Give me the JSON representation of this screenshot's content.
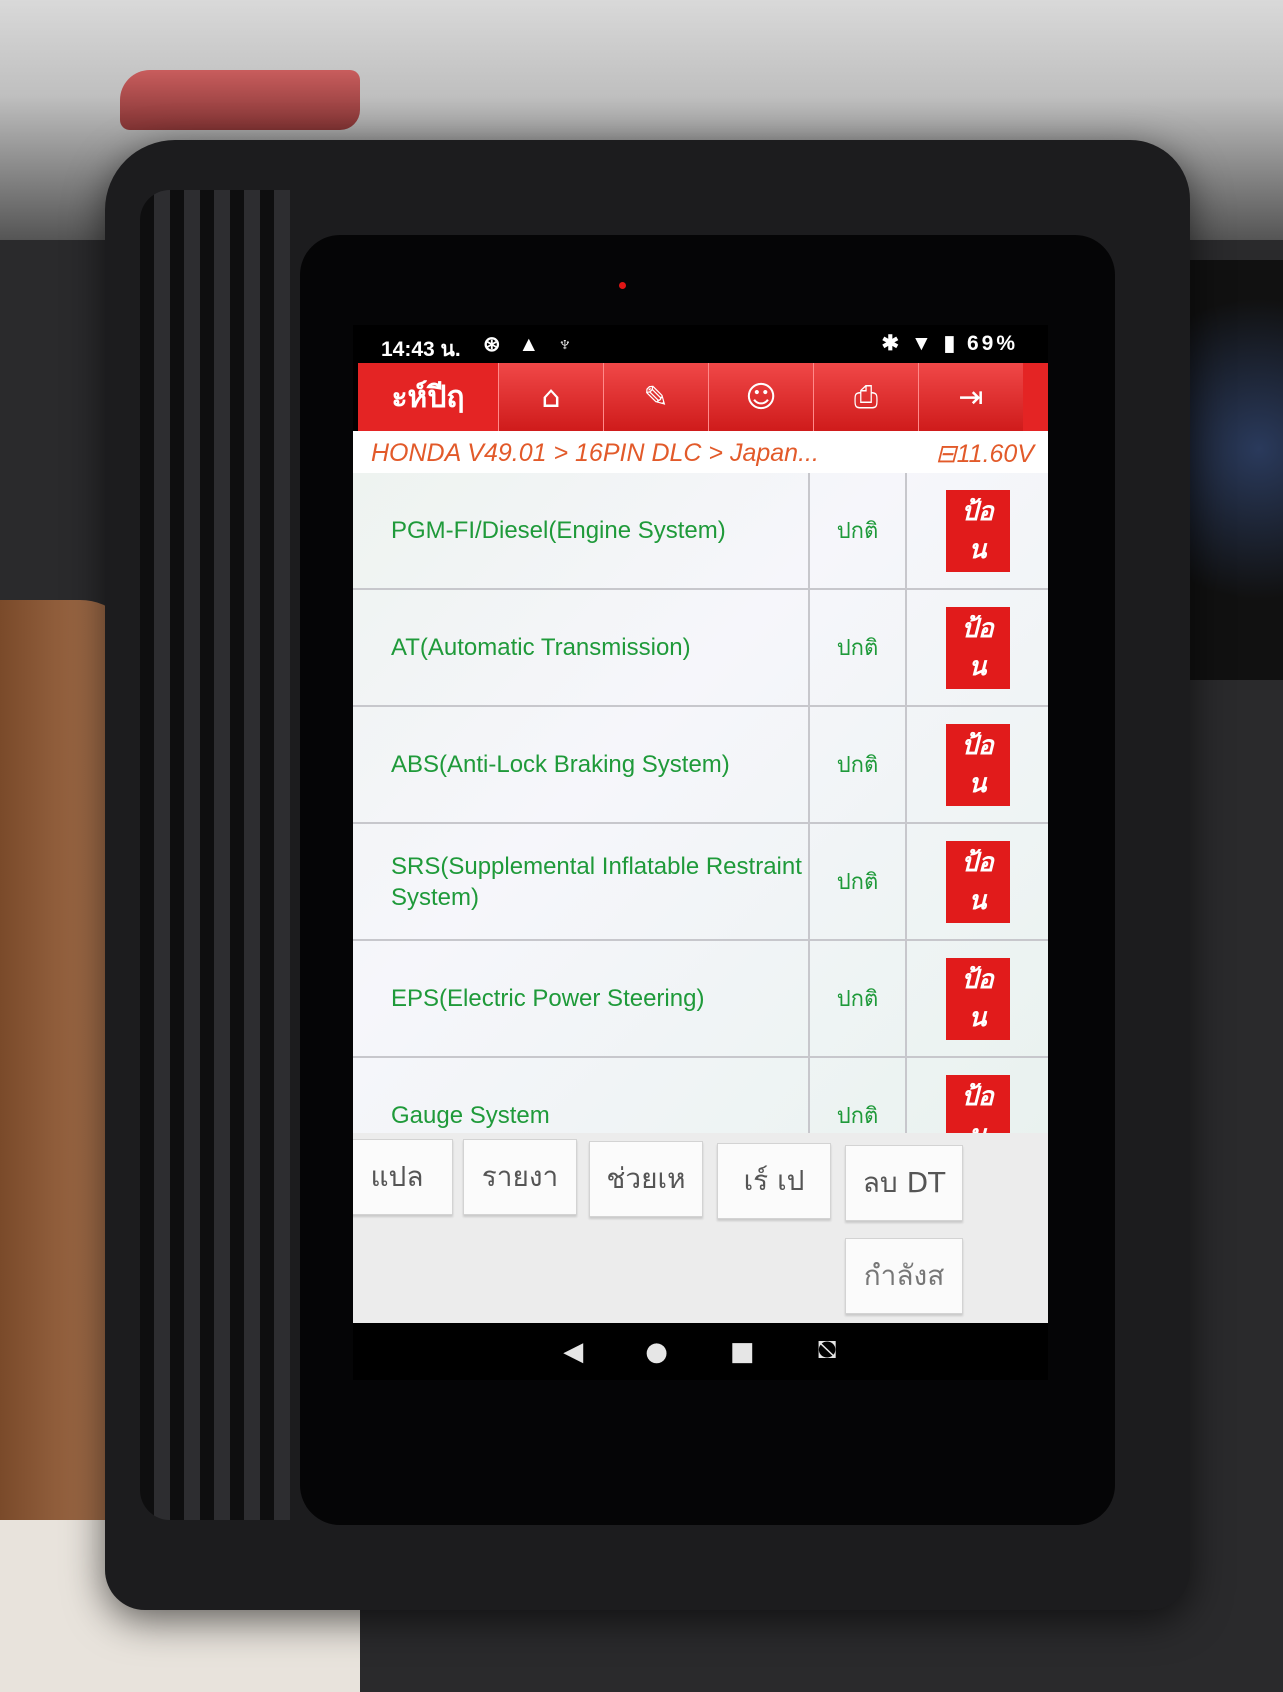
{
  "status_bar": {
    "time": "14:43 น.",
    "left_icons": "⊛ ▲ ♆",
    "right_icons": "✱ ▼ ▮",
    "battery": "69%"
  },
  "toolbar": {
    "title": "ะห์ปีฤ",
    "buttons": [
      {
        "icon": "home-icon",
        "glyph": "⌂"
      },
      {
        "icon": "edit-icon",
        "glyph": "✎"
      },
      {
        "icon": "support-icon",
        "glyph": "☺"
      },
      {
        "icon": "print-icon",
        "glyph": "⎙"
      },
      {
        "icon": "exit-icon",
        "glyph": "⇥"
      }
    ]
  },
  "breadcrumb": {
    "path": "HONDA V49.01 > 16PIN DLC > Japan...",
    "voltage": "⊟11.60V"
  },
  "systems": [
    {
      "name": "PGM-FI/Diesel(Engine System)",
      "status": "ปกติ",
      "action": "ป้อ\nน"
    },
    {
      "name": "AT(Automatic Transmission)",
      "status": "ปกติ",
      "action": "ป้อ\nน"
    },
    {
      "name": "ABS(Anti-Lock Braking System)",
      "status": "ปกติ",
      "action": "ป้อ\nน"
    },
    {
      "name": "SRS(Supplemental Inflatable Restraint System)",
      "status": "ปกติ",
      "action": "ป้อ\nน"
    },
    {
      "name": "EPS(Electric Power Steering)",
      "status": "ปกติ",
      "action": "ป้อ\nน"
    },
    {
      "name": "Gauge System",
      "status": "ปกติ",
      "action": "ป้อ\nน"
    }
  ],
  "footer_buttons": [
    "แปล",
    "รายงา",
    "ช่วยเห",
    "เร์ เป",
    "ลบ DT"
  ],
  "footer_extra": "กำลังส",
  "nav": {
    "back": "◀",
    "home": "●",
    "recents": "■",
    "screenshot": "⛞"
  },
  "colors": {
    "accent": "#e42424",
    "ok_text": "#1f9a3a",
    "breadcrumb": "#e25a2a"
  }
}
